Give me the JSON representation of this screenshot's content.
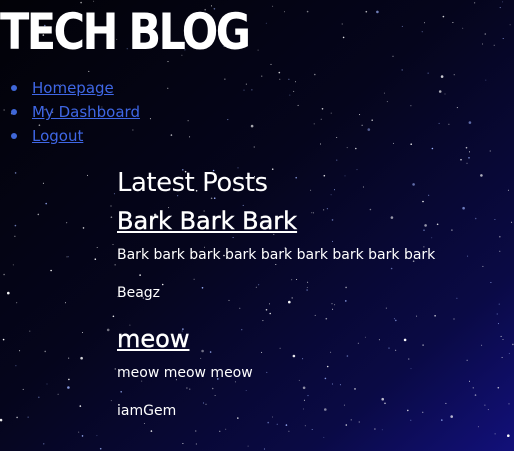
{
  "header": {
    "title": "TECH BLOG"
  },
  "nav": {
    "items": [
      {
        "label": "Homepage"
      },
      {
        "label": "My Dashboard"
      },
      {
        "label": "Logout"
      }
    ]
  },
  "main": {
    "section_title": "Latest Posts",
    "posts": [
      {
        "title": "Bark Bark Bark",
        "body": "Bark bark bark bark bark bark bark bark bark",
        "author": "Beagz"
      },
      {
        "title": "meow",
        "body": "meow meow meow",
        "author": "iamGem"
      }
    ]
  },
  "colors": {
    "background": "#05050f",
    "link": "#3f67e6",
    "text": "#ffffff"
  }
}
